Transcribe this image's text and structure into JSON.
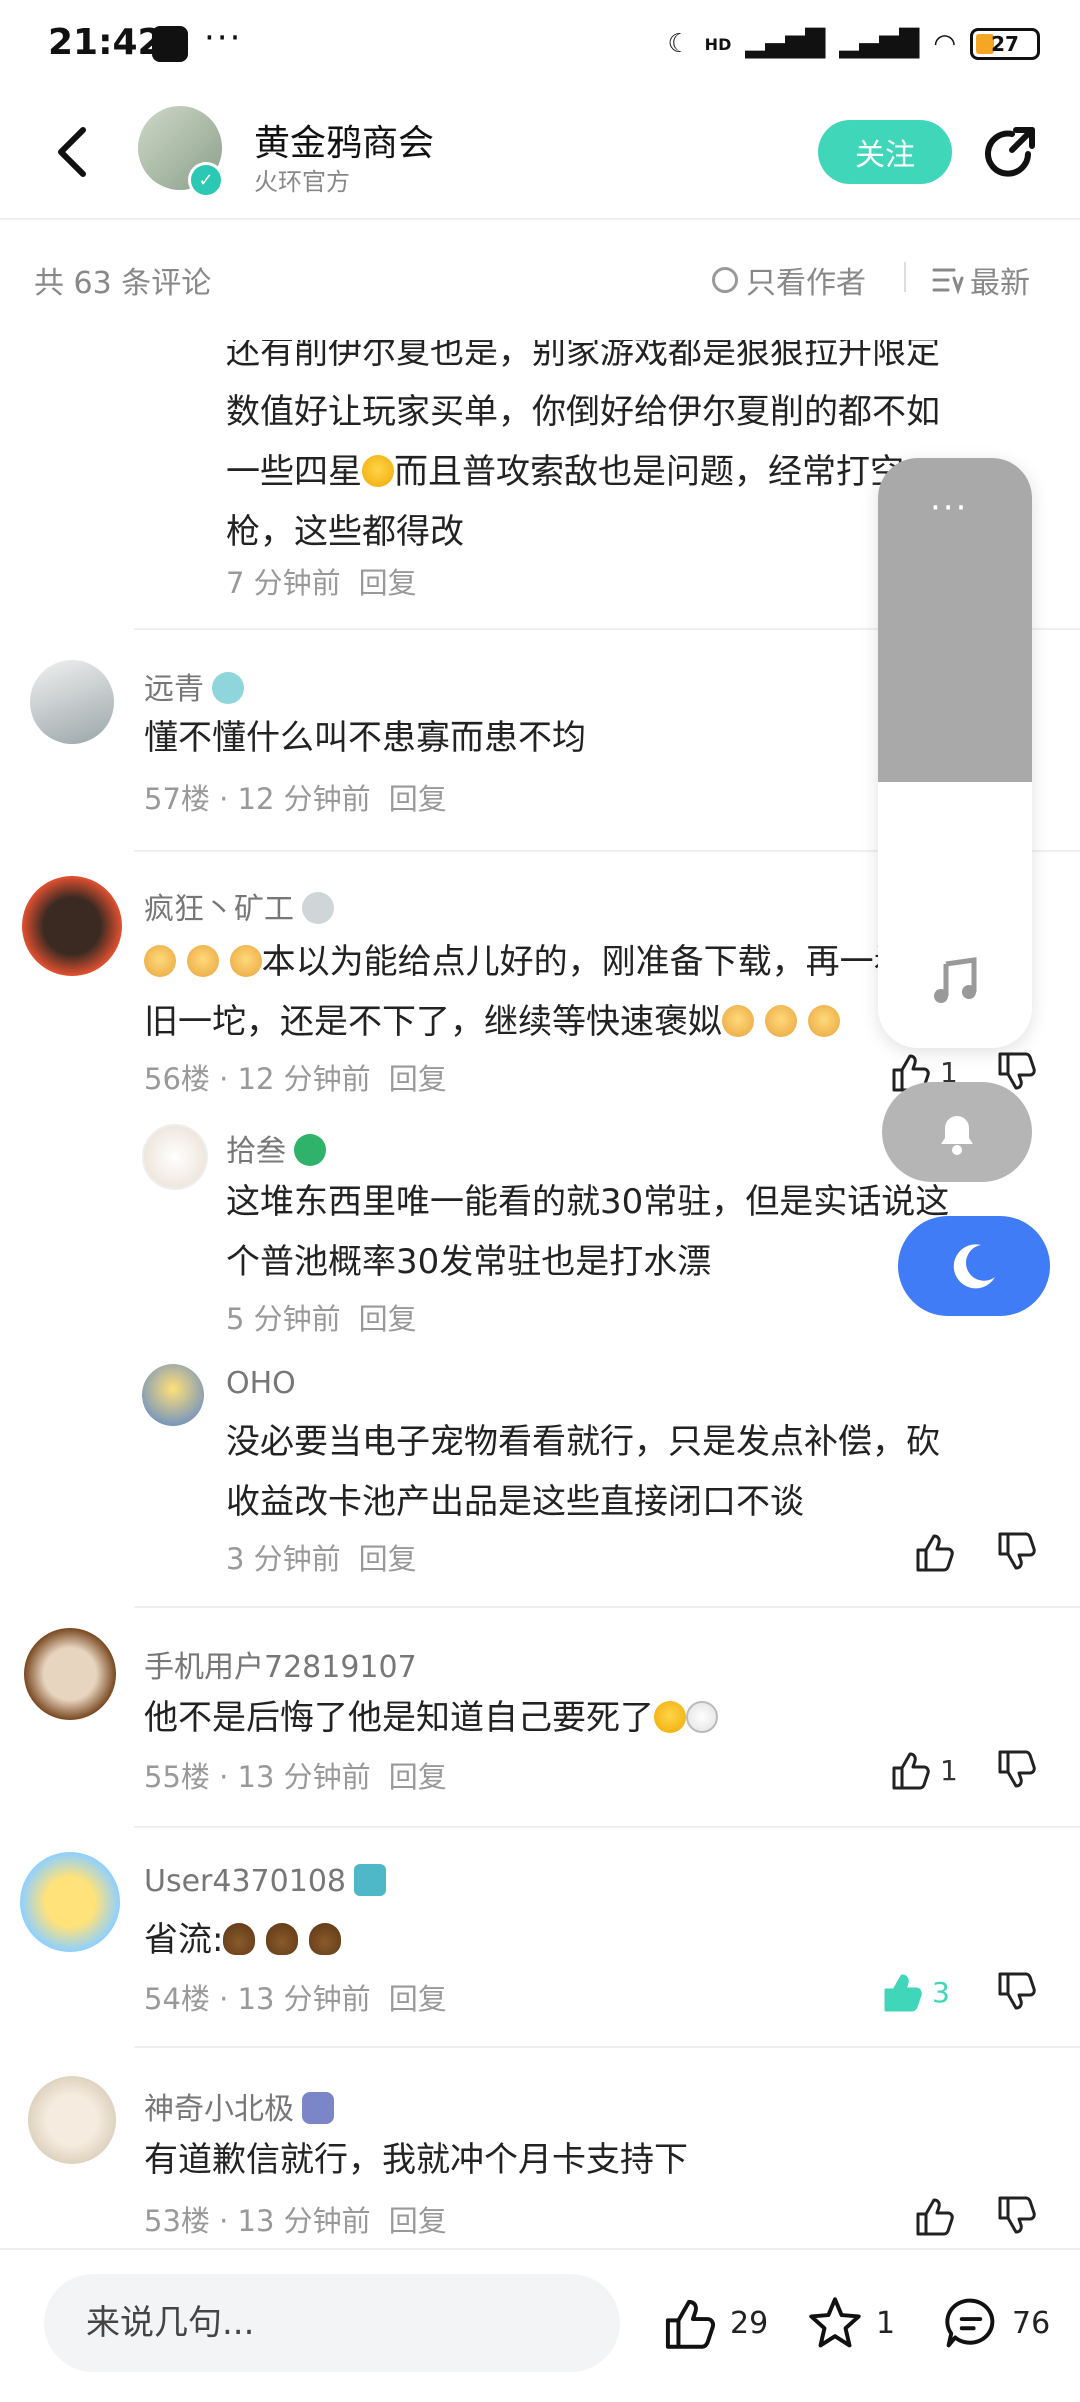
{
  "status_bar": {
    "time": "21:42",
    "more": "···",
    "network": "HD",
    "battery": "27"
  },
  "header": {
    "title": "黄金鸦商会",
    "subtitle": "火环官方",
    "follow_label": "关注"
  },
  "filter": {
    "count": "共 63 条评论",
    "only_author": "只看作者",
    "sort": "最新"
  },
  "comments": [
    {
      "text_lines": [
        "还有削伊尔夏也是，别家游戏都是狠狠拉升限定",
        "数值好让玩家买单，你倒好给伊尔夏削的都不如",
        "一些四星",
        "而且普攻索敌也是问题，经常打空",
        "枪，这些都得改"
      ],
      "time": "7 分钟前",
      "reply": "回复"
    },
    {
      "user": "远青",
      "text": "懂不懂什么叫不患寡而患不均",
      "floor": "57楼 · 12 分钟前",
      "reply": "回复"
    },
    {
      "user": "疯狂丶矿工",
      "text_line1": "本以为能给点儿好的，刚准备下载，再一看",
      "text_line2_a": "旧一坨，还是不下了，继续等快速褒姒",
      "floor": "56楼 · 12 分钟前",
      "reply": "回复",
      "likes": "1"
    },
    {
      "user": "拾叁",
      "text_lines": [
        "这堆东西里唯一能看的就30常驻，但是实话说这",
        "个普池概率30发常驻也是打水漂"
      ],
      "time": "5 分钟前",
      "reply": "回复"
    },
    {
      "user": "OHO",
      "text_lines": [
        "没必要当电子宠物看看就行，只是发点补偿，砍",
        "收益改卡池产出品是这些直接闭口不谈"
      ],
      "time": "3 分钟前",
      "reply": "回复"
    },
    {
      "user": "手机用户72819107",
      "text": "他不是后悔了他是知道自己要死了",
      "floor": "55楼 · 13 分钟前",
      "reply": "回复",
      "likes": "1"
    },
    {
      "user": "User4370108",
      "text": "省流:",
      "floor": "54楼 · 13 分钟前",
      "reply": "回复",
      "likes": "3"
    },
    {
      "user": "神奇小北极",
      "text": "有道歉信就行，我就冲个月卡支持下",
      "floor": "53楼 · 13 分钟前",
      "reply": "回复"
    }
  ],
  "floating": {
    "dots": "···"
  },
  "bottom_bar": {
    "input_placeholder": "来说几句...",
    "likes": "29",
    "favorites": "1",
    "comments": "76"
  },
  "colors": {
    "accent_teal": "#3fd6b9",
    "like_active": "#3fd6b9",
    "moon_blue": "#3f7cf5"
  }
}
